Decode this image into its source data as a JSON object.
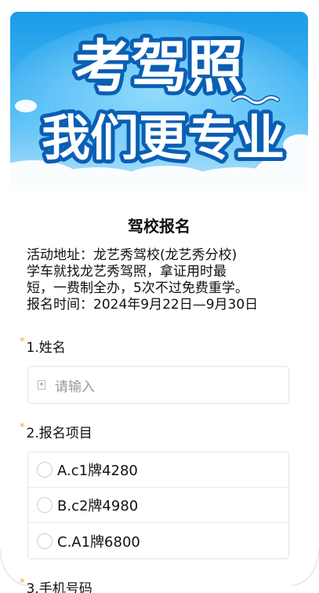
{
  "banner": {
    "line1": "考驾照",
    "line2": "我们更专业",
    "colors": {
      "sky": "#3aaef2",
      "text": "#ffffff",
      "outline": "#0a5fb4"
    }
  },
  "form": {
    "title": "驾校报名",
    "description": [
      "活动地址：龙艺秀驾校(龙艺秀分校)",
      "学车就找龙艺秀驾照，拿证用时最",
      "短，一费制全办，5次不过免费重学。",
      "报名时间：2024年9月22日—9月30日"
    ],
    "required_mark": "*",
    "q1": {
      "label": "1.姓名",
      "placeholder": "请输入"
    },
    "q2": {
      "label": "2.报名项目",
      "options": [
        "A.c1牌4280",
        "B.c2牌4980",
        "C.A1牌6800"
      ]
    },
    "q3": {
      "label": "3.手机号码"
    }
  }
}
